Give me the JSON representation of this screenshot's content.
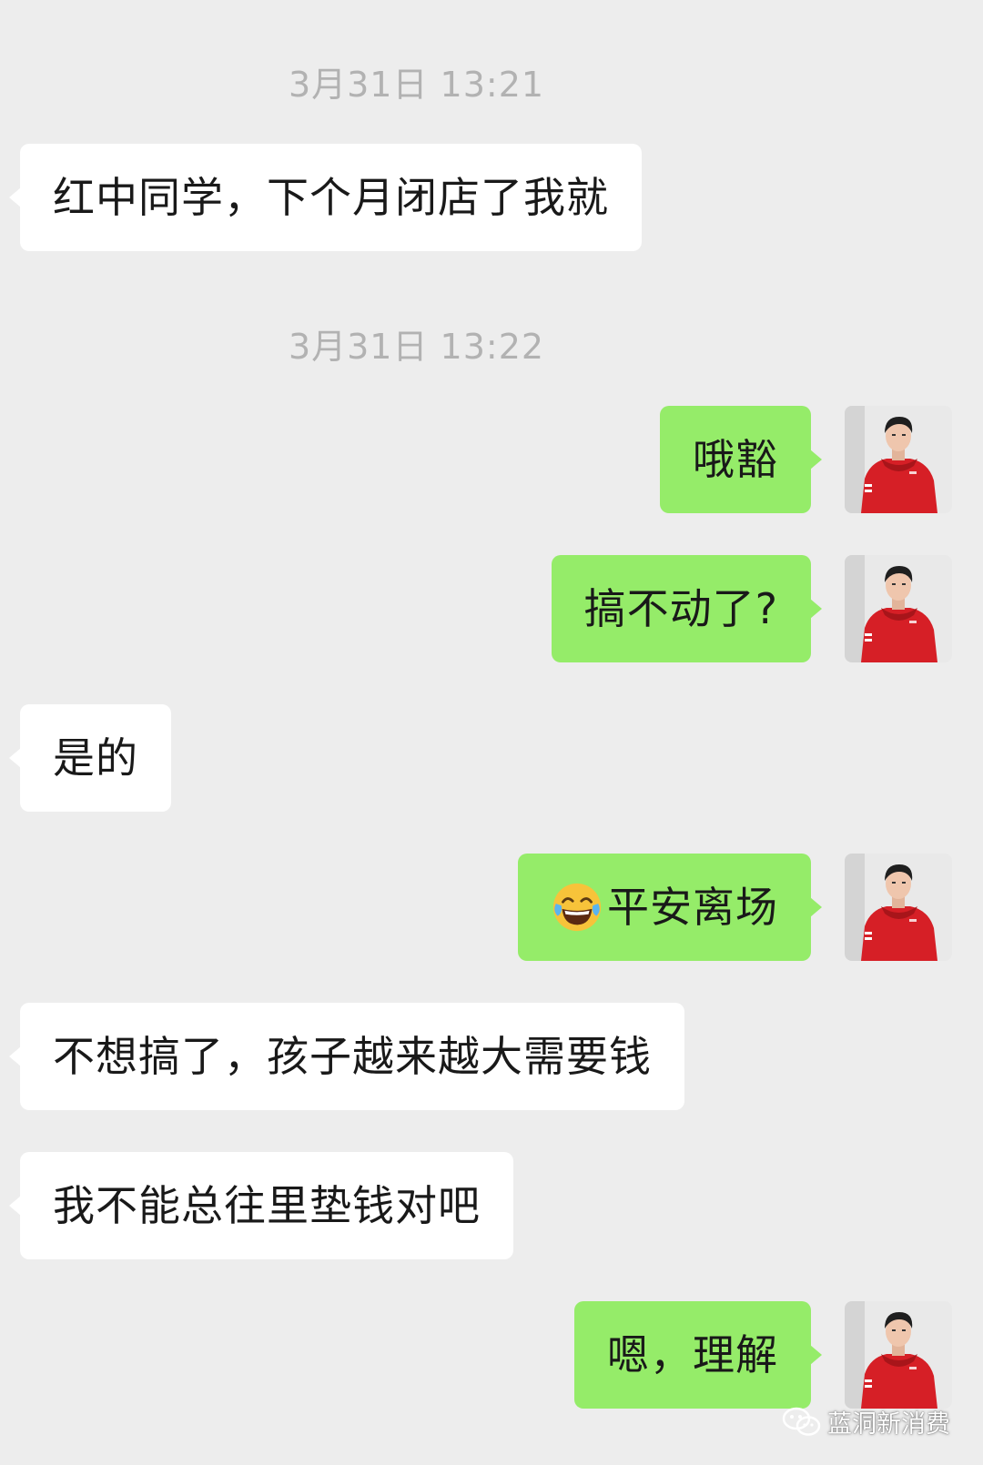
{
  "chat": {
    "timestamps": [
      "3月31日 13:21",
      "3月31日 13:22"
    ],
    "messages": [
      {
        "side": "in",
        "text": "红中同学，下个月闭店了我就"
      },
      {
        "side": "out",
        "text": "哦豁"
      },
      {
        "side": "out",
        "text": "搞不动了?"
      },
      {
        "side": "in",
        "text": "是的"
      },
      {
        "side": "out",
        "emoji": "tears-of-joy-emoji",
        "text": "平安离场"
      },
      {
        "side": "in",
        "text": "不想搞了，孩子越来越大需要钱"
      },
      {
        "side": "in",
        "text": "我不能总往里垫钱对吧"
      },
      {
        "side": "out",
        "text": "嗯，理解"
      }
    ]
  },
  "watermark": {
    "icon": "wechat-icon",
    "text": "蓝洞新消费"
  },
  "colors": {
    "background": "#ededed",
    "incoming_bubble": "#ffffff",
    "outgoing_bubble": "#95ec69",
    "timestamp": "#b2b2b2"
  }
}
